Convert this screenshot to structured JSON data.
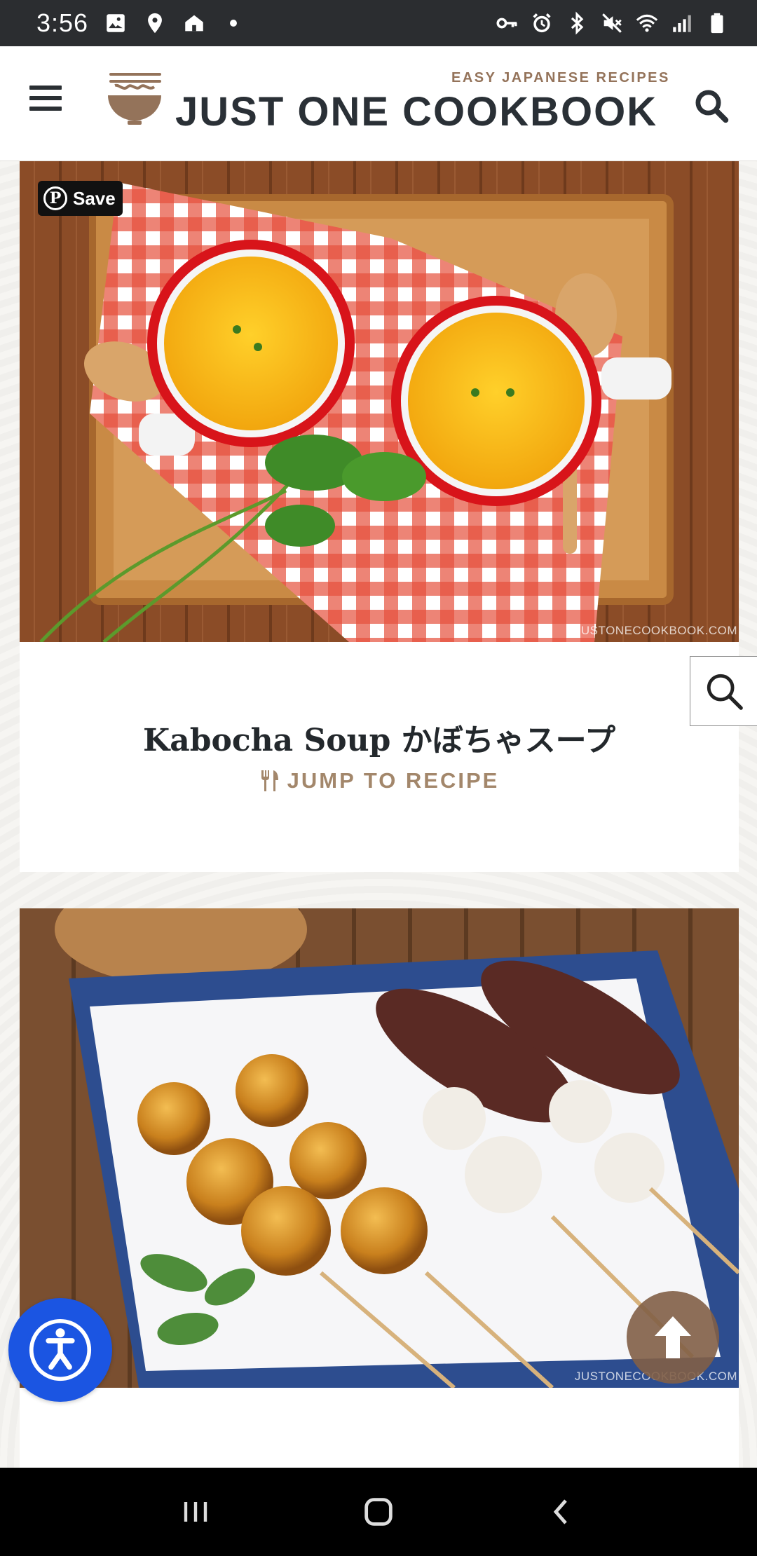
{
  "status_bar": {
    "time": "3:56"
  },
  "header": {
    "tagline": "EASY JAPANESE RECIPES",
    "site_name": "JUST ONE COOKBOOK",
    "brand_color": "#2a3036",
    "accent_color": "#94735a"
  },
  "cards": [
    {
      "save_label": "Save",
      "watermark": "JUSTONECOOKBOOK.COM",
      "title": "Kabocha Soup かぼちゃスープ",
      "jump_label": "JUMP TO RECIPE"
    },
    {
      "watermark": "JUSTONECOOKBOOK.COM"
    }
  ],
  "icons": {
    "menu": "hamburger-icon",
    "search": "search-icon",
    "utensils": "fork-knife-icon",
    "accessibility": "accessibility-icon",
    "scroll_top": "arrow-up-icon"
  }
}
